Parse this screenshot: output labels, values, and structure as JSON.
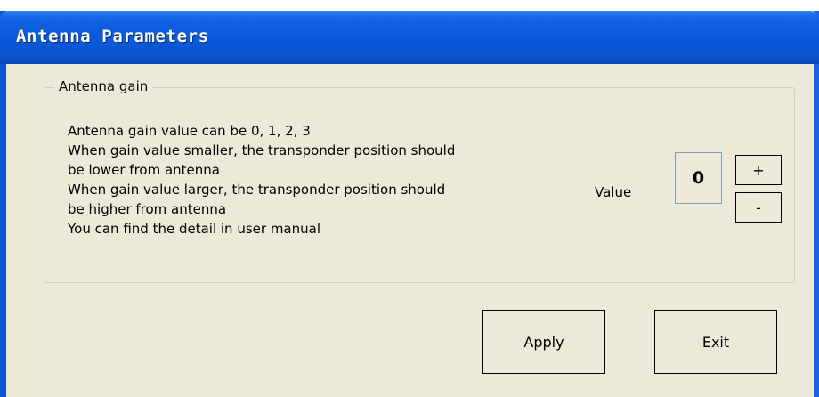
{
  "window": {
    "title": "Antenna Parameters"
  },
  "group": {
    "title": "Antenna gain",
    "description_lines": [
      "Antenna gain value can be 0, 1, 2, 3",
      "When gain value smaller, the transponder position should",
      "be lower from antenna",
      "When gain value larger, the transponder position should",
      "be higher from antenna",
      "You can find the detail in user manual"
    ],
    "value_label": "Value",
    "value": "0",
    "increment_label": "+",
    "decrement_label": "-"
  },
  "buttons": {
    "apply_label": "Apply",
    "exit_label": "Exit"
  },
  "colors": {
    "titlebar": "#0b56d6",
    "window_bg": "#ece9d8",
    "value_border": "#7f9db9"
  }
}
